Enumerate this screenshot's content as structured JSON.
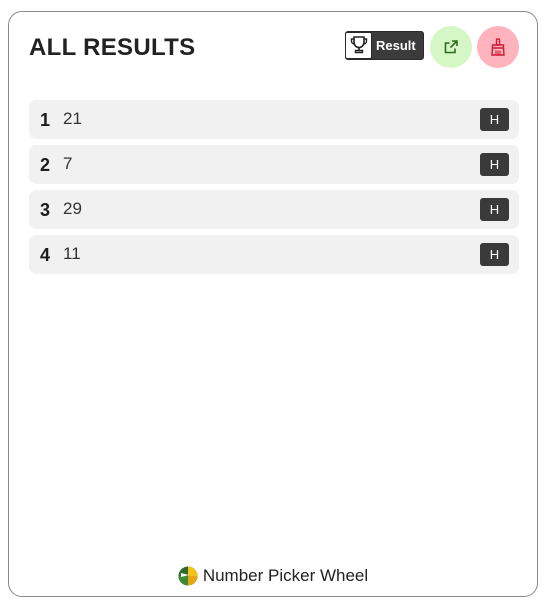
{
  "header": {
    "title": "ALL RESULTS",
    "result_label": "Result"
  },
  "results": [
    {
      "index": "1",
      "value": "21",
      "action": "H"
    },
    {
      "index": "2",
      "value": "7",
      "action": "H"
    },
    {
      "index": "3",
      "value": "29",
      "action": "H"
    },
    {
      "index": "4",
      "value": "11",
      "action": "H"
    }
  ],
  "footer": {
    "app_name": "Number Picker Wheel"
  },
  "colors": {
    "share_bg": "#d4f7c5",
    "clear_bg": "#ffb3bd",
    "dark_button": "#3a3a3a",
    "row_bg": "#f1f1f1"
  },
  "icons": {
    "result": "trophy-icon",
    "share": "external-link-icon",
    "clear": "broom-icon",
    "logo": "wheel-logo-icon"
  }
}
